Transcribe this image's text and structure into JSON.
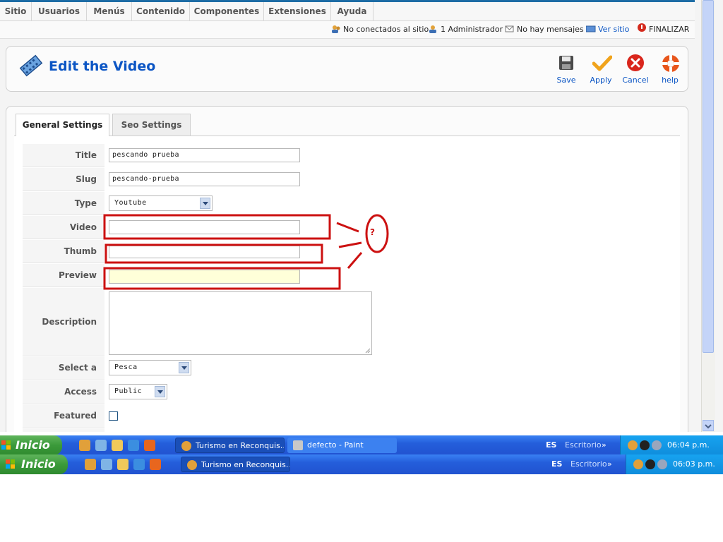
{
  "menu": [
    "Sitio",
    "Usuarios",
    "Menús",
    "Contenido",
    "Componentes",
    "Extensiones",
    "Ayuda"
  ],
  "status": {
    "offline_label": "No conectados al sitio",
    "admins_label": "1 Administrador",
    "messages_label": "No hay mensajes",
    "view_site_label": "Ver sitio",
    "logout_label": "FINALIZAR"
  },
  "page": {
    "title": "Edit the Video"
  },
  "toolbar": {
    "save": "Save",
    "apply": "Apply",
    "cancel": "Cancel",
    "help": "help"
  },
  "tabs": [
    "General Settings",
    "Seo Settings"
  ],
  "form": {
    "title_label": "Title",
    "title_value": "pescando prueba",
    "slug_label": "Slug",
    "slug_value": "pescando-prueba",
    "type_label": "Type",
    "type_value": "Youtube",
    "video_label": "Video",
    "video_value": "",
    "thumb_label": "Thumb",
    "thumb_value": "",
    "preview_label": "Preview",
    "preview_value": "",
    "description_label": "Description",
    "category_label": "Select a Category",
    "category_value": "Pesca",
    "access_label": "Access",
    "access_value": "Public",
    "featured_label": "Featured",
    "featured_checked": false
  },
  "annotation": {
    "question_mark": "?",
    "color": "#cc1111"
  },
  "taskbar_top": {
    "start_label": "Inicio",
    "windows": [
      "Turismo en Reconquis...",
      "defecto - Paint"
    ],
    "lang": "ES",
    "desktop_label": "Escritorio",
    "time": "06:04 p.m."
  },
  "taskbar_bottom": {
    "start_label": "Inicio",
    "windows": [
      "Turismo en Reconquis..."
    ],
    "lang": "ES",
    "desktop_label": "Escritorio",
    "time": "06:03 p.m."
  },
  "colors": {
    "accent": "#0b55c4",
    "taskbar": "#245edb",
    "start": "#3b9a3a",
    "tray": "#0f8ddc"
  }
}
